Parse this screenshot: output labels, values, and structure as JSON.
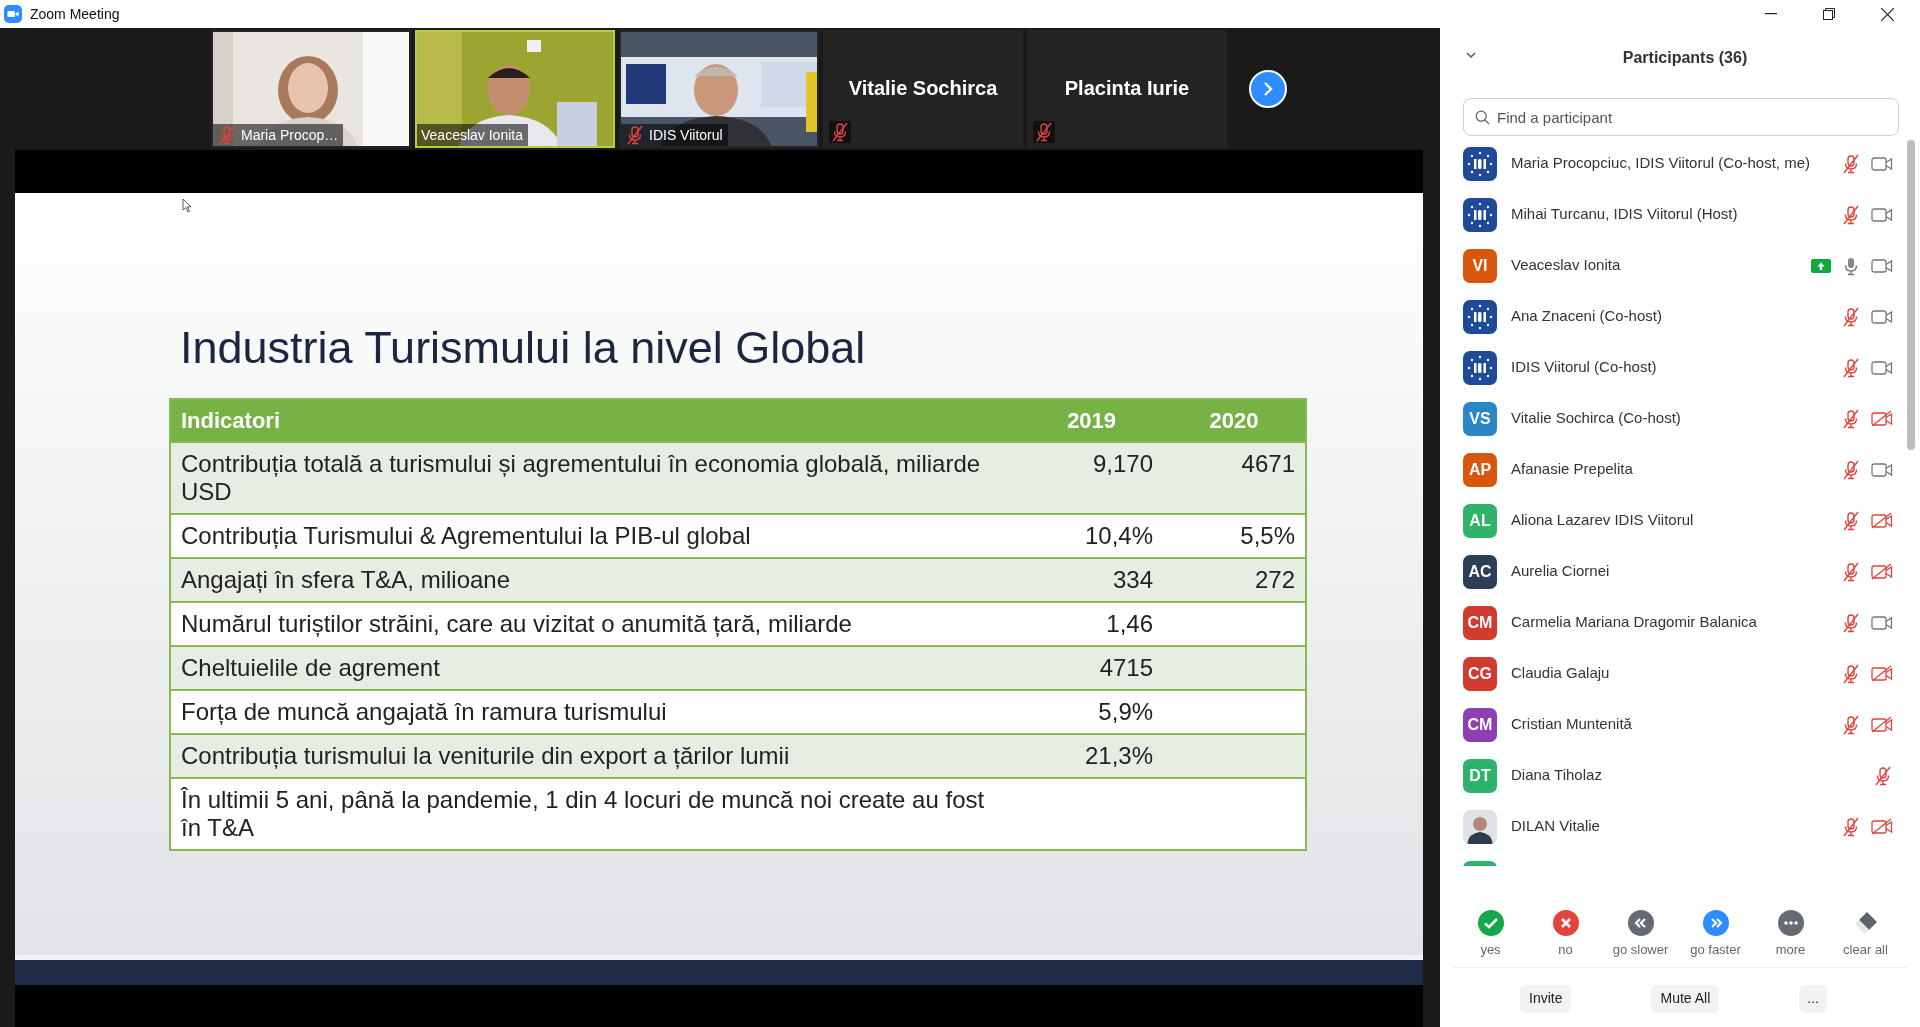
{
  "window": {
    "title": "Zoom Meeting"
  },
  "video_strip": {
    "tiles": [
      {
        "kind": "video",
        "name": "Maria Procop…",
        "muted": true,
        "active": false
      },
      {
        "kind": "video",
        "name": "Veaceslav Ionita",
        "muted": false,
        "active": true
      },
      {
        "kind": "video",
        "name": "IDIS Viitorul",
        "muted": true,
        "active": false
      },
      {
        "kind": "name",
        "name": "Vitalie Sochirca",
        "muted": true,
        "active": false
      },
      {
        "kind": "name",
        "name": "Placinta Iurie",
        "muted": true,
        "active": false
      }
    ]
  },
  "slide": {
    "title": "Industria Turismului la nivel Global",
    "table": {
      "columns": [
        "Indicatori",
        "2019",
        "2020"
      ],
      "rows": [
        {
          "cells": [
            "Contribuția totală a turismului și agrementului în economia globală, miliarde USD",
            "9,170",
            "4671"
          ]
        },
        {
          "cells": [
            "Contribuția Turismului & Agrementului la PIB-ul global",
            "10,4%",
            "5,5%"
          ]
        },
        {
          "cells": [
            "Angajați în sfera T&A, milioane",
            "334",
            "272"
          ]
        },
        {
          "cells": [
            "Numărul turiștilor străini, care au vizitat o anumită țară, miliarde",
            "1,46",
            ""
          ]
        },
        {
          "cells": [
            "Cheltuielile de agrement",
            "4715",
            ""
          ]
        },
        {
          "cells": [
            "Forța de muncă angajată în ramura turismului",
            "5,9%",
            ""
          ]
        },
        {
          "cells": [
            "Contribuția turismului la veniturile din export a țărilor lumii",
            "21,3%",
            ""
          ]
        },
        {
          "cells": [
            "În ultimii 5 ani, până la pandemie, 1 din 4 locuri de muncă noi create au fost în T&A",
            "",
            ""
          ]
        }
      ]
    }
  },
  "participants": {
    "title": "Participants (36)",
    "search": {
      "placeholder": "Find a participant"
    },
    "items": [
      {
        "name": "Maria Procopciuc, IDIS Viitorul (Co-host, me)",
        "kind": "logo",
        "muted": true,
        "video_icon": true,
        "video_off": false,
        "badge": false
      },
      {
        "name": "Mihai Turcanu, IDIS Viitorul (Host)",
        "kind": "logo",
        "muted": true,
        "video_icon": true,
        "video_off": false,
        "badge": false
      },
      {
        "name": "Veaceslav Ionita",
        "kind": "initials",
        "initials": "VI",
        "color": "#d9560f",
        "muted": false,
        "video_icon": true,
        "video_off": false,
        "badge": true
      },
      {
        "name": "Ana Znaceni (Co-host)",
        "kind": "logo",
        "muted": true,
        "video_icon": true,
        "video_off": false,
        "badge": false
      },
      {
        "name": "IDIS Viitorul (Co-host)",
        "kind": "logo",
        "muted": true,
        "video_icon": true,
        "video_off": false,
        "badge": false
      },
      {
        "name": "Vitalie Sochirca (Co-host)",
        "kind": "initials",
        "initials": "VS",
        "color": "#2b86c5",
        "muted": true,
        "video_icon": true,
        "video_off": true,
        "badge": false
      },
      {
        "name": "Afanasie Prepelita",
        "kind": "initials",
        "initials": "AP",
        "color": "#d9560f",
        "muted": true,
        "video_icon": true,
        "video_off": false,
        "badge": false
      },
      {
        "name": "Aliona Lazarev IDIS Viitorul",
        "kind": "initials",
        "initials": "AL",
        "color": "#2fb36a",
        "muted": true,
        "video_icon": true,
        "video_off": true,
        "badge": false
      },
      {
        "name": "Aurelia Ciornei",
        "kind": "initials",
        "initials": "AC",
        "color": "#2c3e58",
        "muted": true,
        "video_icon": true,
        "video_off": true,
        "badge": false
      },
      {
        "name": "Carmelia Mariana Dragomir Balanica",
        "kind": "initials",
        "initials": "CM",
        "color": "#d23b30",
        "muted": true,
        "video_icon": true,
        "video_off": false,
        "badge": false
      },
      {
        "name": "Claudia Galaju",
        "kind": "initials",
        "initials": "CG",
        "color": "#d23b30",
        "muted": true,
        "video_icon": true,
        "video_off": true,
        "badge": false
      },
      {
        "name": "Cristian Muntenită",
        "kind": "initials",
        "initials": "CM",
        "color": "#8e3fb3",
        "muted": true,
        "video_icon": true,
        "video_off": true,
        "badge": false
      },
      {
        "name": "Diana Tiholaz",
        "kind": "initials",
        "initials": "DT",
        "color": "#2fb36a",
        "muted": true,
        "video_icon": false,
        "badge": false
      },
      {
        "name": "DILAN Vitalie",
        "muted": true,
        "video_icon": true,
        "video_off": true,
        "badge": false
      }
    ],
    "cut_off_avatar": {
      "color": "#2fb36a"
    }
  },
  "reactions": [
    {
      "kind": "yes",
      "label": "yes"
    },
    {
      "kind": "no",
      "label": "no"
    },
    {
      "kind": "slower",
      "label": "go slower"
    },
    {
      "kind": "faster",
      "label": "go faster"
    },
    {
      "kind": "more",
      "label": "more"
    },
    {
      "kind": "clear",
      "label": "clear all"
    }
  ],
  "buttons": [
    "Invite",
    "Mute All",
    "..."
  ]
}
